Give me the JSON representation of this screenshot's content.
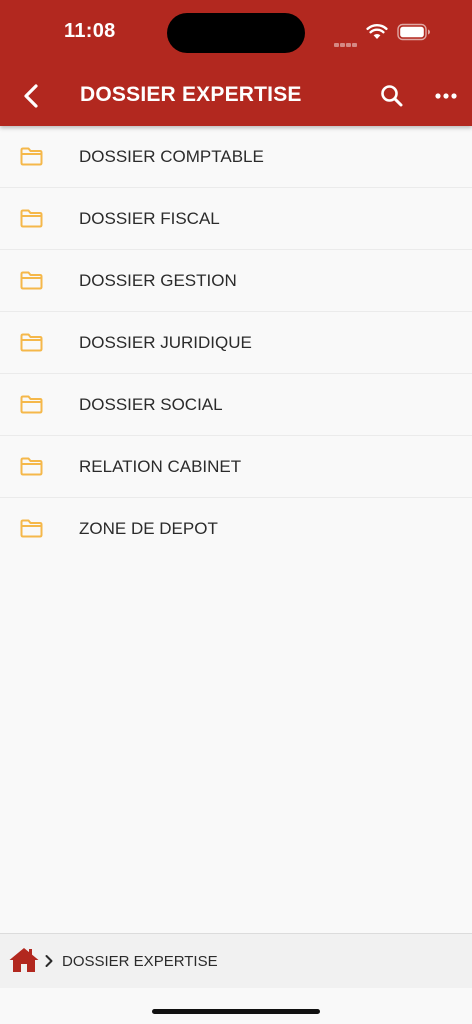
{
  "status_bar": {
    "time": "11:08"
  },
  "header": {
    "title": "DOSSIER EXPERTISE",
    "back_icon": "chevron-left-icon",
    "search_icon": "search-icon",
    "more_icon": "more-horizontal-icon",
    "background_color": "#b2281f"
  },
  "folders": [
    {
      "label": "DOSSIER COMPTABLE",
      "icon": "folder-icon"
    },
    {
      "label": "DOSSIER FISCAL",
      "icon": "folder-icon"
    },
    {
      "label": "DOSSIER GESTION",
      "icon": "folder-icon"
    },
    {
      "label": "DOSSIER JURIDIQUE",
      "icon": "folder-icon"
    },
    {
      "label": "DOSSIER SOCIAL",
      "icon": "folder-icon"
    },
    {
      "label": "RELATION CABINET",
      "icon": "folder-icon"
    },
    {
      "label": "ZONE DE DEPOT",
      "icon": "folder-icon"
    }
  ],
  "folder_icon_color": "#f5b84a",
  "breadcrumb": {
    "home_icon": "home-icon",
    "separator_icon": "chevron-right-icon",
    "current": "DOSSIER EXPERTISE"
  }
}
